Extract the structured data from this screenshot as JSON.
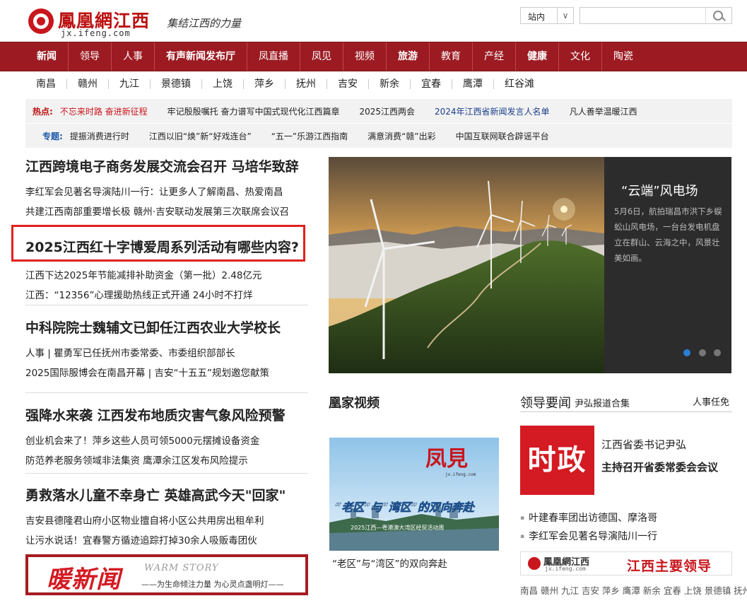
{
  "header": {
    "logo_title": "鳳凰網江西",
    "logo_domain": "jx.ifeng.com",
    "logo_slogan": "集结江西的力量",
    "search_scope": "站内",
    "search_placeholder": ""
  },
  "main_nav": [
    "新闻",
    "领导",
    "人事",
    "有声新闻发布厅",
    "凤直播",
    "凤见",
    "视频",
    "旅游",
    "教育",
    "产经",
    "健康",
    "文化",
    "陶瓷"
  ],
  "main_nav_bold": [
    true,
    false,
    false,
    true,
    false,
    false,
    false,
    true,
    false,
    false,
    true,
    false,
    false
  ],
  "city_nav": [
    "南昌",
    "赣州",
    "九江",
    "景德镇",
    "上饶",
    "萍乡",
    "抚州",
    "吉安",
    "新余",
    "宜春",
    "鹰潭",
    "红谷滩"
  ],
  "hot": {
    "label": "热点:",
    "items": [
      "不忘来时路 奋进新征程",
      "牢记殷殷嘱托 奋力谱写中国式现代化江西篇章",
      "2025江西两会",
      "2024年江西省新闻发言人名单",
      "凡人善举温暖江西"
    ]
  },
  "topic": {
    "label": "专题:",
    "items": [
      "提振消费进行时",
      "江西以旧“焕”新“好戏连台”",
      "“五一”乐游江西指南",
      "满意消费“赣”出彩",
      "中国互联网联合辟谣平台"
    ]
  },
  "news_groups": [
    {
      "headline": "江西跨境电子商务发展交流会召开 马培华致辞",
      "subs": [
        "李红军会见著名导演陆川一行：让更多人了解南昌、热爱南昌",
        "共建江西南部重要增长极 赣州·吉安联动发展第三次联席会议召"
      ]
    },
    {
      "headline": "2025江西红十字博爱周系列活动有哪些内容?",
      "subs": [
        "江西下达2025年节能减排补助资金（第一批）2.48亿元",
        "江西：“12356”心理援助热线正式开通 24小时不打烊"
      ]
    },
    {
      "headline": "中科院院士魏辅文已卸任江西农业大学校长",
      "subs": [
        "人事 | 瞿勇军已任抚州市委常委、市委组织部部长",
        "2025国际服博会在南昌开幕 | 吉安“十五五”规划邀您献策"
      ]
    },
    {
      "headline": "强降水来袭 江西发布地质灾害气象风险预警",
      "subs": [
        "创业机会来了！萍乡这些人员可领5000元摆摊设备资金",
        "防范养老服务领域非法集资 鹰潭余江区发布风险提示"
      ]
    },
    {
      "headline": "勇救落水儿童不幸身亡 英雄高武今天\"回家\"",
      "subs": [
        "吉安县德隆君山府小区物业擅自将小区公共用房出租牟利",
        "让污水说话！宜春警方循迹追踪打掉30余人吸贩毒团伙"
      ]
    }
  ],
  "warm_news": {
    "title": "暖新闻",
    "en": "WARM STORY",
    "tagline": "——为生命倾注力量 为心灵点盏明灯——"
  },
  "slideshow": {
    "title": "“云端”风电场",
    "desc": "5月6日，航拍瑞昌市洪下乡蜈蚣山风电场，一台台发电机盘立在群山、云海之中，风景壮美如画。",
    "dots": 3,
    "active": 0
  },
  "video": {
    "section_title": "凰家视频",
    "thumb_brand": "凤見",
    "thumb_domain": "jx.ifeng.com",
    "thumb_headline": "“老区”与“湾区”的双向奔赴",
    "thumb_sub": "2025江西—粤港澳大湾区经贸活动周",
    "caption": "“老区”与“湾区”的双向奔赴"
  },
  "leaders": {
    "section_title": "领导要闻",
    "sub_link": "尹弘报道合集",
    "more_link": "人事任免",
    "block_text": "时政",
    "feature_line1": "江西省委书记尹弘",
    "feature_line2": "主持召开省委常委会会议",
    "list": [
      "叶建春率团出访德国、摩洛哥",
      "李红军会见著名导演陆川一行"
    ],
    "banner_brand": "鳳凰網江西",
    "banner_domain": "jx.ifeng.com",
    "banner_text": "江西主要领导",
    "cities_line": "南昌 赣州 九江 吉安 萍乡 鹰潭 新余 宜春 上饶 景德镇 抚州"
  },
  "colors": {
    "brand_red": "#9c1b22",
    "accent_red": "#d41a22",
    "highlight_box": "#e02020",
    "dot_active": "#2a7fd4"
  }
}
